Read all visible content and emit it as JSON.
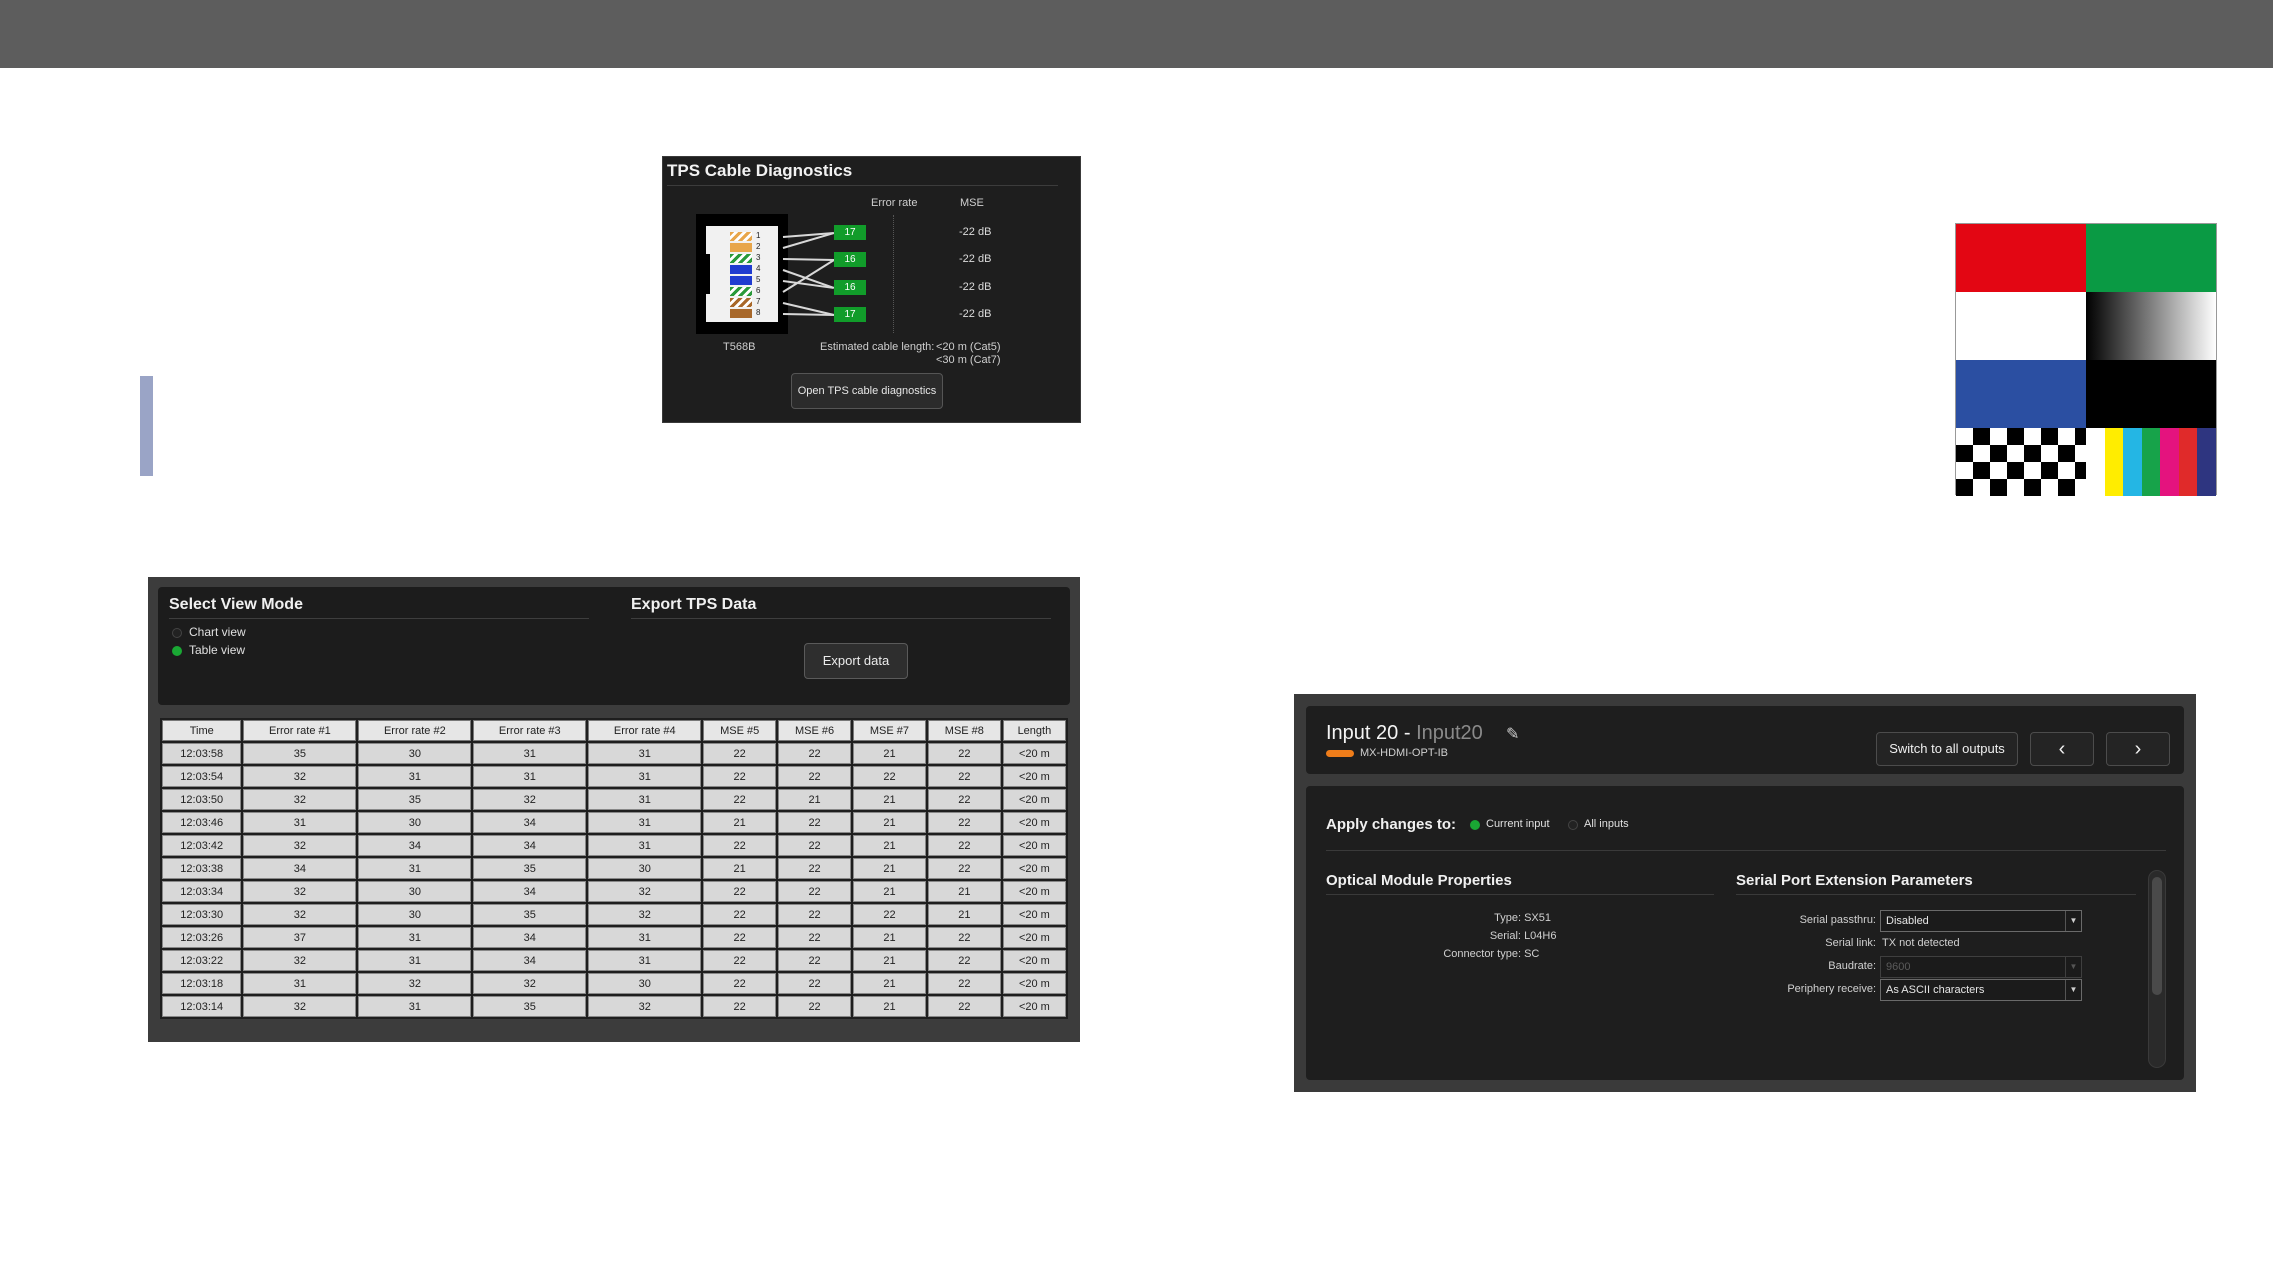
{
  "tps_diag": {
    "title": "TPS Cable Diagnostics",
    "col_error": "Error rate",
    "col_mse": "MSE",
    "pairs": [
      {
        "error": "17",
        "mse": "-22 dB"
      },
      {
        "error": "16",
        "mse": "-22 dB"
      },
      {
        "error": "16",
        "mse": "-22 dB"
      },
      {
        "error": "17",
        "mse": "-22 dB"
      }
    ],
    "pin_colors": [
      "#e8a64a",
      "#e8a64a",
      "#2a9a3a",
      "#1f3bd0",
      "#1f3bd0",
      "#2a9a3a",
      "#a8682a",
      "#a8682a"
    ],
    "pin_numbers": [
      "1",
      "2",
      "3",
      "4",
      "5",
      "6",
      "7",
      "8"
    ],
    "standard": "T568B",
    "est_label": "Estimated cable length:",
    "est_cat5": "<20 m (Cat5)",
    "est_cat7": "<30 m (Cat7)",
    "open_button": "Open TPS cable diagnostics",
    "accent": "#119c2a"
  },
  "test_pattern": {
    "colors": [
      "#e30613",
      "#0a9a44",
      "#ffffff",
      "#2b4fa2",
      "#000000"
    ],
    "color_bars": [
      "#ffffff",
      "#ffed00",
      "#24b6e4",
      "#17a34a",
      "#e4137e",
      "#e02a2a",
      "#2e3580"
    ]
  },
  "view_mode": {
    "title": "Select View Mode",
    "options": [
      {
        "label": "Chart view",
        "selected": false
      },
      {
        "label": "Table view",
        "selected": true
      }
    ],
    "export_title": "Export TPS Data",
    "export_button": "Export data"
  },
  "tps_table": {
    "headers": [
      "Time",
      "Error rate #1",
      "Error rate #2",
      "Error rate #3",
      "Error rate #4",
      "MSE #5",
      "MSE #6",
      "MSE #7",
      "MSE #8",
      "Length"
    ],
    "rows": [
      [
        "12:03:58",
        "35",
        "30",
        "31",
        "31",
        "22",
        "22",
        "21",
        "22",
        "<20 m"
      ],
      [
        "12:03:54",
        "32",
        "31",
        "31",
        "31",
        "22",
        "22",
        "22",
        "22",
        "<20 m"
      ],
      [
        "12:03:50",
        "32",
        "35",
        "32",
        "31",
        "22",
        "21",
        "21",
        "22",
        "<20 m"
      ],
      [
        "12:03:46",
        "31",
        "30",
        "34",
        "31",
        "21",
        "22",
        "21",
        "22",
        "<20 m"
      ],
      [
        "12:03:42",
        "32",
        "34",
        "34",
        "31",
        "22",
        "22",
        "21",
        "22",
        "<20 m"
      ],
      [
        "12:03:38",
        "34",
        "31",
        "35",
        "30",
        "21",
        "22",
        "21",
        "22",
        "<20 m"
      ],
      [
        "12:03:34",
        "32",
        "30",
        "34",
        "32",
        "22",
        "22",
        "21",
        "21",
        "<20 m"
      ],
      [
        "12:03:30",
        "32",
        "30",
        "35",
        "32",
        "22",
        "22",
        "22",
        "21",
        "<20 m"
      ],
      [
        "12:03:26",
        "37",
        "31",
        "34",
        "31",
        "22",
        "22",
        "21",
        "22",
        "<20 m"
      ],
      [
        "12:03:22",
        "32",
        "31",
        "34",
        "31",
        "22",
        "22",
        "21",
        "22",
        "<20 m"
      ],
      [
        "12:03:18",
        "31",
        "32",
        "32",
        "30",
        "22",
        "22",
        "21",
        "22",
        "<20 m"
      ],
      [
        "12:03:14",
        "32",
        "31",
        "35",
        "32",
        "22",
        "22",
        "21",
        "22",
        "<20 m"
      ]
    ]
  },
  "input_panel": {
    "title_prefix": "Input 20 -",
    "title_alias": "Input20",
    "model": "MX-HDMI-OPT-IB",
    "switch_button": "Switch to all outputs",
    "prev_icon": "‹",
    "next_icon": "›",
    "apply_label": "Apply changes to:",
    "apply_options": [
      {
        "label": "Current input",
        "selected": true
      },
      {
        "label": "All inputs",
        "selected": false
      }
    ],
    "optical_title": "Optical Module Properties",
    "optical": [
      {
        "key": "Type:",
        "value": "SX51"
      },
      {
        "key": "Serial:",
        "value": "L04H6"
      },
      {
        "key": "Connector type:",
        "value": "SC"
      }
    ],
    "serial_title": "Serial Port Extension Parameters",
    "serial_passthru_label": "Serial passthru:",
    "serial_passthru_value": "Disabled",
    "serial_link_label": "Serial link:",
    "serial_link_value": "TX not detected",
    "baudrate_label": "Baudrate:",
    "baudrate_value": "9600",
    "periphery_label": "Periphery receive:",
    "periphery_value": "As ASCII characters",
    "accent": "#ef7d1a"
  }
}
